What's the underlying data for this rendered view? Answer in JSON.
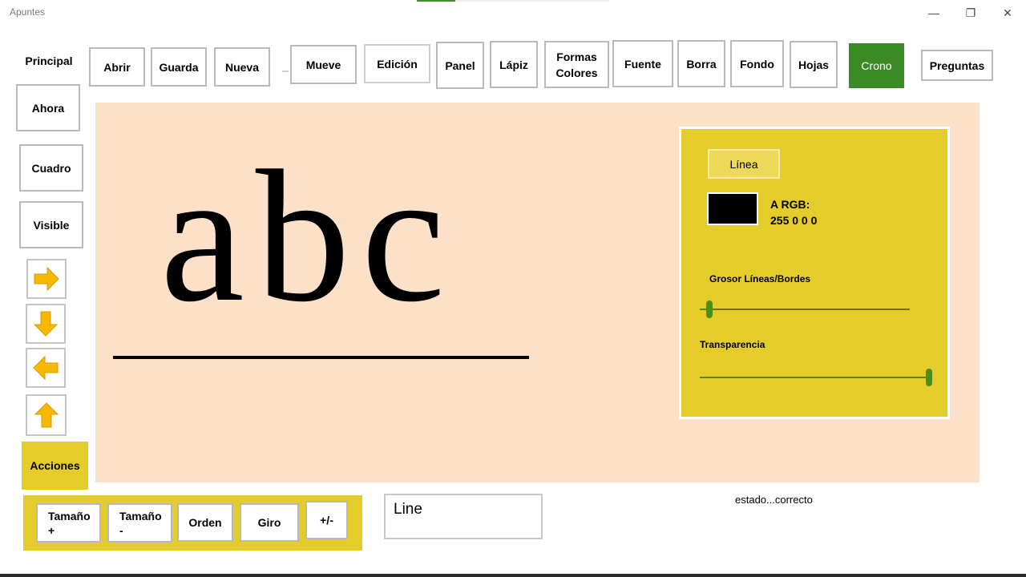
{
  "window": {
    "title": "Apuntes",
    "minimize_glyph": "—",
    "restore_glyph": "❐",
    "close_glyph": "✕",
    "progress_fraction": 0.2
  },
  "toolbar": {
    "principal_label": "Principal",
    "buttons": [
      "Abrir",
      "Guarda",
      "Nueva",
      "Mueve",
      "Edición",
      "Panel",
      "Lápiz",
      "Formas Colores",
      "Fuente",
      "Borra",
      "Fondo",
      "Hojas",
      "Crono",
      "Preguntas"
    ]
  },
  "sidebar": {
    "buttons": [
      "Ahora",
      "Cuadro",
      "Visible"
    ],
    "arrows": [
      "arrow-right-icon",
      "arrow-down-icon",
      "arrow-left-icon",
      "arrow-up-icon"
    ],
    "acciones_label": "Acciones"
  },
  "canvas": {
    "sample_text": "abc"
  },
  "panel": {
    "linea_button": "Línea",
    "color_label": "A RGB:",
    "color_value": "255 0 0 0",
    "swatch_color": "#000000",
    "grosor_label": "Grosor Líneas/Bordes",
    "grosor_value": 0.03,
    "transparencia_label": "Transparencia",
    "transparencia_value": 1.0
  },
  "bottom": {
    "buttons": [
      "Tamaño +",
      "Tamaño -",
      "Orden",
      "Giro",
      "+/-"
    ],
    "shape_name": "Line",
    "status": "estado...correcto"
  },
  "colors": {
    "canvas_bg": "#fde0c8",
    "panel_bg": "#e4cc2a",
    "crono_bg": "#3b8a26",
    "slider_green": "#4d8c16",
    "arrow_yellow": "#f7b800"
  }
}
